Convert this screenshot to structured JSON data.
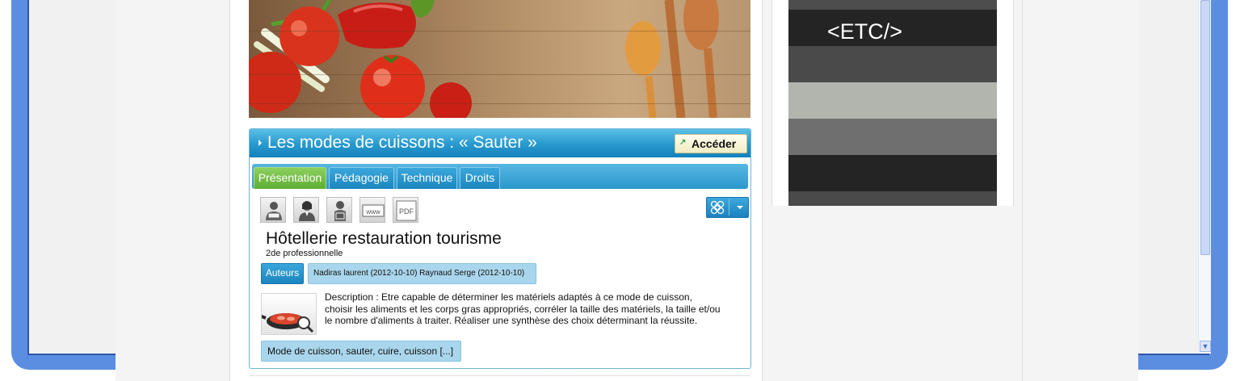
{
  "ad": {
    "etc_text": "<ETC/>",
    "bands": [
      "#4d4d4d",
      "#242424",
      "#4a4a4a",
      "#b1b5ae",
      "#6f6f6f",
      "#242424",
      "#4a4a4a"
    ]
  },
  "resource": {
    "title": "Les modes de cuissons : « Sauter »",
    "access_label": "Accéder",
    "tabs": [
      "Présentation",
      "Pédagogie",
      "Technique",
      "Droits"
    ],
    "active_tab": "Présentation",
    "icons": [
      "teacher-icon",
      "student-icon",
      "person-icon",
      "www-icon",
      "pdf-icon"
    ],
    "level_title": "Hôtellerie restauration tourisme",
    "level_subtitle": "2de professionnelle",
    "authors_label": "Auteurs",
    "authors_value": "Nadiras laurent (2012-10-10) Raynaud Serge (2012-10-10)",
    "description": "Description : Etre capable de déterminer les matériels adaptés à ce mode de cuisson, choisir les aliments et les corps gras appropriés, corréler la taille des matériels, la taille et/ou le nombre d'aliments à traiter. Réaliser une synthèse des choix déterminant la réussite.",
    "keywords": "Mode de cuisson, sauter, cuire, cuisson [...]"
  },
  "colors": {
    "bezel": "#5b8ee0",
    "header_blue": "#2a9cd0",
    "active_tab_green": "#6ab83e",
    "tag_blue": "#a9d6ec"
  }
}
